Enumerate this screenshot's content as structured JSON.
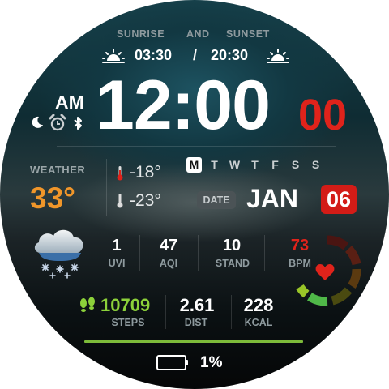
{
  "sun": {
    "sunrise_label": "SUNRISE",
    "and_label": "AND",
    "sunset_label": "SUNSET",
    "sunrise_time": "03:30",
    "separator": "/",
    "sunset_time": "20:30"
  },
  "time": {
    "ampm": "AM",
    "hours_minutes": "12:00",
    "seconds": "00"
  },
  "weather": {
    "label": "WEATHER",
    "temperature": "33°",
    "high": "-18°",
    "low": "-23°"
  },
  "week": {
    "days": [
      "M",
      "T",
      "W",
      "T",
      "F",
      "S",
      "S"
    ],
    "active_index": 0
  },
  "date": {
    "label": "DATE",
    "month": "JAN",
    "day": "06"
  },
  "metrics": [
    {
      "value": "1",
      "label": "UVI"
    },
    {
      "value": "47",
      "label": "AQI"
    },
    {
      "value": "10",
      "label": "STAND"
    },
    {
      "value": "73",
      "label": "BPM"
    }
  ],
  "activity": [
    {
      "value": "10709",
      "label": "STEPS"
    },
    {
      "value": "2.61",
      "label": "DIST"
    },
    {
      "value": "228",
      "label": "KCAL"
    }
  ],
  "battery": {
    "percent_text": "1%",
    "level": 0.01
  },
  "colors": {
    "seconds": "#e0231b",
    "temperature": "#f0962a",
    "steps": "#8cd13a",
    "bpm": "#e0231b",
    "date_day_bg": "#d31c17",
    "progress_line": "#7dbb3a"
  },
  "icons": {
    "sunrise": "sunrise-icon",
    "sunset": "sunset-icon",
    "moon": "moon-icon",
    "alarm": "alarm-icon",
    "bluetooth": "bluetooth-icon",
    "thermometer": "thermometer-icon",
    "weather": "snow-cloud-icon",
    "heart": "heart-icon",
    "steps": "footprints-icon",
    "battery": "battery-icon"
  }
}
